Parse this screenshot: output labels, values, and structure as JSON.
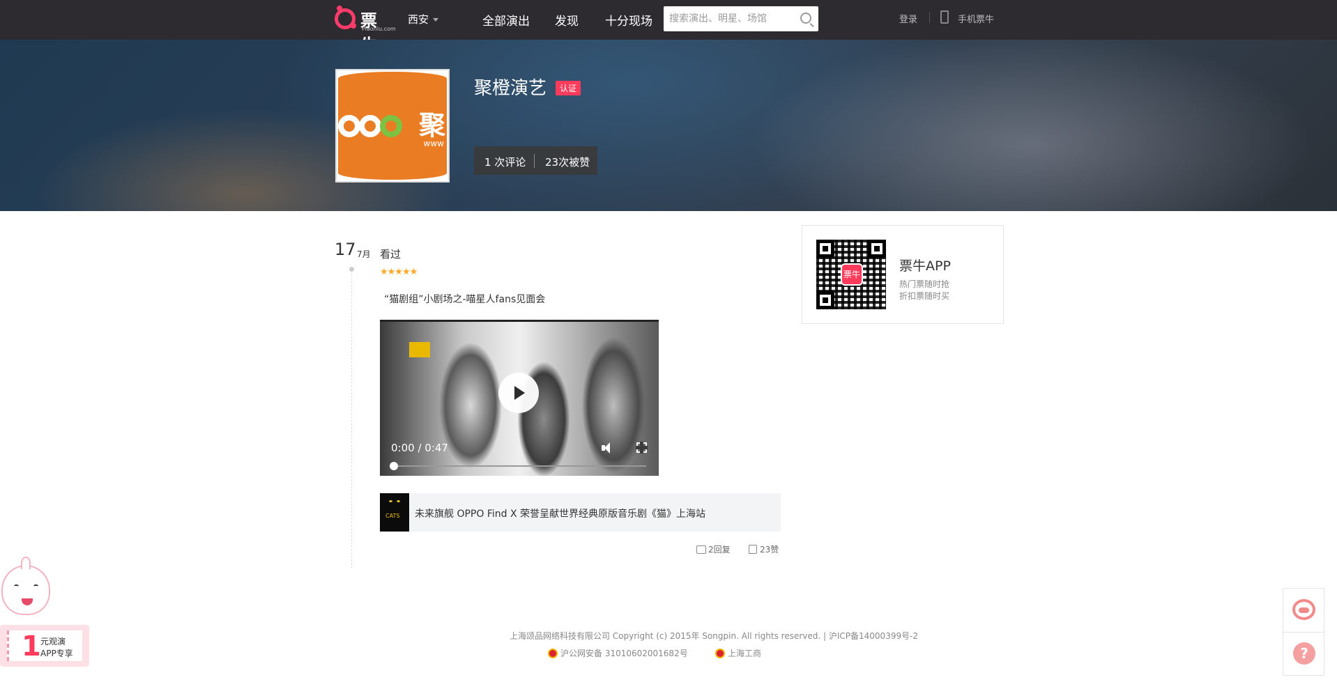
{
  "header": {
    "logo_text": "票牛",
    "logo_sub": "Piaoniu.com",
    "city": "西安",
    "nav": [
      "全部演出",
      "发现",
      "十分现场"
    ],
    "search_placeholder": "搜索演出、明星、场馆",
    "login": "登录",
    "mobile": "手机票牛"
  },
  "profile": {
    "avatar_char": "聚",
    "avatar_sub": "www",
    "name": "聚橙演艺",
    "badge": "认证",
    "stat_reviews": "1 次评论",
    "stat_likes": "23次被赞"
  },
  "review": {
    "day": "17",
    "month": "7月",
    "status": "看过",
    "stars": "★★★★★",
    "rating": 5,
    "title": "“猫剧组”小剧场之-喵星人fans见面会",
    "video": {
      "time": "0:00 / 0:47",
      "progress": 0
    },
    "show_poster_text": "CATS",
    "show_name": "未来旗舰 OPPO Find X 荣誉呈献世界经典原版音乐剧《猫》上海站",
    "replies": "2回复",
    "likes": "23赞"
  },
  "app": {
    "qr_label": "票牛",
    "name": "票牛APP",
    "line1": "热门票随时抢",
    "line2": "折扣票随时买"
  },
  "footer": {
    "copyright": "上海颂品网络科技有限公司 Copyright (c) 2015年 Songpin. All rights reserved. | 沪ICP备14000399号-2",
    "police": "沪公网安备 31010602001682号",
    "business": "上海工商"
  },
  "promo": {
    "num": "1",
    "line1": "元观演",
    "line2": "APP专享"
  },
  "side": {
    "help": "?"
  },
  "colors": {
    "accent": "#ff3b5c",
    "topbar": "#2d2b30",
    "star": "#ffa726",
    "avatar_bg": "#ea7d23"
  }
}
